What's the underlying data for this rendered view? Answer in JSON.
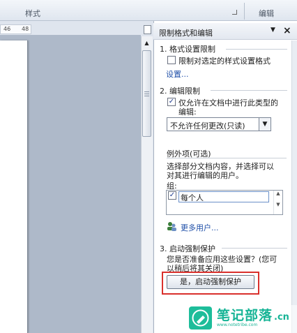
{
  "ribbon": {
    "styles_group": "样式",
    "edit_group": "编辑"
  },
  "ruler": {
    "ticks": [
      "46",
      "48"
    ]
  },
  "pane": {
    "title": "限制格式和编辑",
    "section1": {
      "heading": "1. 格式设置限制",
      "checkbox_label": "限制对选定的样式设置格式",
      "checkbox_checked": false,
      "settings_link": "设置..."
    },
    "section2": {
      "heading": "2. 编辑限制",
      "checkbox_label_line1": "仅允许在文档中进行此类型的",
      "checkbox_label_line2": "编辑:",
      "checkbox_checked": true,
      "edit_type_value": "不允许任何更改(只读)",
      "exceptions_heading": "例外项(可选)",
      "exceptions_desc_line1": "选择部分文档内容，并选择可以",
      "exceptions_desc_line2": "对其进行编辑的用户。",
      "groups_label": "组:",
      "group_item": "每个人",
      "group_item_checked": true,
      "more_users_link": "更多用户..."
    },
    "section3": {
      "heading": "3. 启动强制保护",
      "question_line1": "您是否准备应用这些设置？(您可",
      "question_line2": "以稍后将其关闭)",
      "start_button": "是，启动强制保护"
    }
  },
  "watermark": {
    "brand": "笔记部落",
    "suffix": ".cn",
    "url": "www.notetribe.com"
  },
  "colors": {
    "accent_red": "#d9302c",
    "link_blue": "#1f4fa8",
    "brand_green": "#1dbd9a"
  }
}
